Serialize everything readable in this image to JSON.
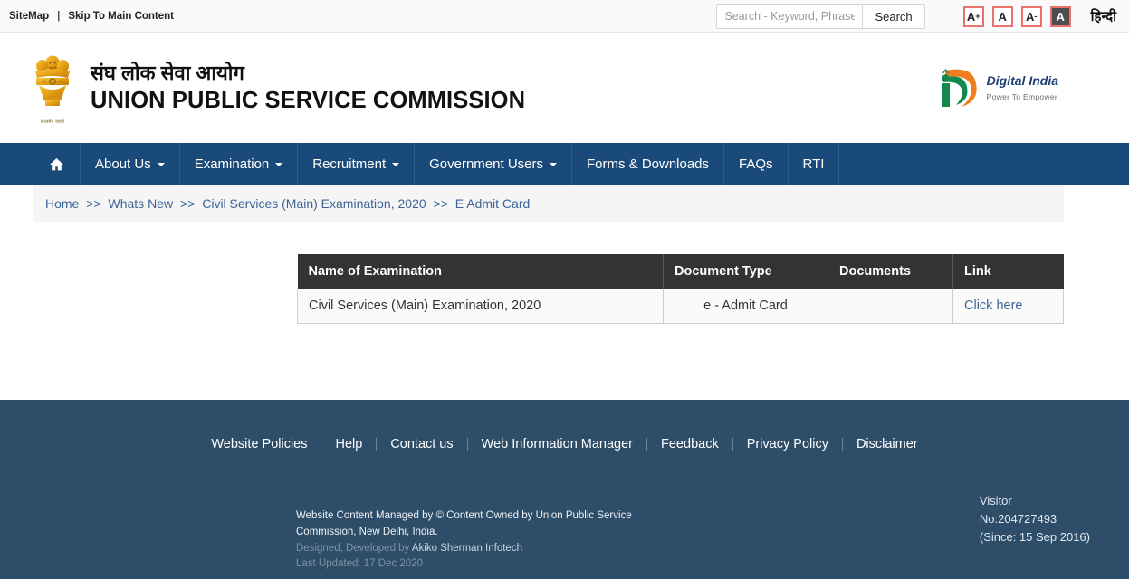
{
  "topbar": {
    "sitemap": "SiteMap",
    "separator": "|",
    "skip": "Skip To Main Content"
  },
  "search": {
    "placeholder": "Search - Keyword, Phrase",
    "value": "",
    "button": "Search"
  },
  "accessibility": {
    "increase": "A",
    "increase_sup": "+",
    "normal": "A",
    "decrease": "A",
    "decrease_sup": "-",
    "contrast": "A",
    "language": "हिन्दी"
  },
  "masthead": {
    "emblem_caption": "सत्यमेव जयते",
    "title_hindi": "संघ लोक सेवा आयोग",
    "title_english": "UNION PUBLIC SERVICE COMMISSION",
    "digital_india_name": "Digital India",
    "digital_india_tagline": "Power To Empower"
  },
  "nav": {
    "home_icon": "home-icon",
    "items": [
      {
        "label": "About Us",
        "caret": true
      },
      {
        "label": "Examination",
        "caret": true
      },
      {
        "label": "Recruitment",
        "caret": true
      },
      {
        "label": "Government Users",
        "caret": true
      },
      {
        "label": "Forms & Downloads",
        "caret": false
      },
      {
        "label": "FAQs",
        "caret": false
      },
      {
        "label": "RTI",
        "caret": false
      }
    ]
  },
  "breadcrumb": {
    "items": [
      "Home",
      "Whats New",
      "Civil Services (Main) Examination, 2020",
      "E Admit Card"
    ],
    "separator": ">>"
  },
  "table": {
    "headers": [
      "Name of Examination",
      "Document Type",
      "Documents",
      "Link"
    ],
    "rows": [
      {
        "name": "Civil Services (Main) Examination, 2020",
        "doc_type": "e - Admit Card",
        "documents": "",
        "link": "Click here"
      }
    ]
  },
  "footer": {
    "links": [
      "Website Policies",
      "Help",
      "Contact us",
      "Web Information Manager",
      "Feedback",
      "Privacy Policy",
      "Disclaimer"
    ],
    "managed_by": "Website Content Managed by © Content Owned by Union Public Service Commission, New Delhi, India.",
    "designed_prefix": "Designed, Developed by ",
    "designed_by": "Akiko Sherman Infotech",
    "last_updated": "Last Updated: 17 Dec 2020",
    "visitor_label": "Visitor",
    "visitor_number": "No:204727493",
    "visitor_since": "(Since: 15 Sep 2016)"
  },
  "colors": {
    "nav_blue": "#1a4a7a",
    "footer_blue": "#2e4d68",
    "table_header": "#333333",
    "link_blue": "#3c6597",
    "accent_red": "#e8736a"
  }
}
